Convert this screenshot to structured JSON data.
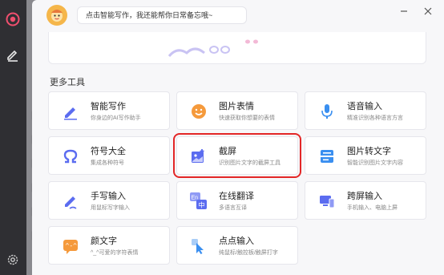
{
  "header": {
    "assistant_message": "点击智能写作，我还能帮你日常备忘哦~",
    "minimize_icon": "minus-icon",
    "close_icon": "close-icon"
  },
  "section": {
    "title": "更多工具"
  },
  "tools": [
    {
      "id": "smart-writing",
      "name": "智能写作",
      "desc": "你身边的AI写作助手",
      "icon": "pen-icon",
      "color": "#5b6cf0"
    },
    {
      "id": "image-emoji",
      "name": "图片表情",
      "desc": "快速获取你想要的表情",
      "icon": "smiley-icon",
      "color": "#f59a3c"
    },
    {
      "id": "voice-input",
      "name": "语音输入",
      "desc": "精准识别各种语言方言",
      "icon": "microphone-icon",
      "color": "#3a8ff0"
    },
    {
      "id": "symbols",
      "name": "符号大全",
      "desc": "集成各种符号",
      "icon": "omega-icon",
      "color": "#5b6cf0"
    },
    {
      "id": "screenshot",
      "name": "截屏",
      "desc": "识别图片文字的截屏工具",
      "icon": "screenshot-icon",
      "color": "#5b6cf0"
    },
    {
      "id": "image-to-text",
      "name": "图片转文字",
      "desc": "智能识别图片文字内容",
      "icon": "scan-text-icon",
      "color": "#3a8ff0"
    },
    {
      "id": "handwriting",
      "name": "手写输入",
      "desc": "用鼠标写字输入",
      "icon": "pencil-icon",
      "color": "#5b6cf0"
    },
    {
      "id": "translate",
      "name": "在线翻译",
      "desc": "多语言互译",
      "icon": "translate-icon",
      "color": "#5b6cf0",
      "badge_en": "En",
      "badge_zh": "中"
    },
    {
      "id": "cross-screen",
      "name": "跨屏输入",
      "desc": "手机输入、电脑上屏",
      "icon": "devices-icon",
      "color": "#5b6cf0"
    },
    {
      "id": "kaomoji",
      "name": "颜文字",
      "desc": "^_^可爱的字符表情",
      "icon": "kaomoji-icon",
      "color": "#f59a3c"
    },
    {
      "id": "click-input",
      "name": "点点输入",
      "desc": "纯鼠标/触控板/触屏打字",
      "icon": "cursor-click-icon",
      "color": "#3a8ff0"
    }
  ],
  "selected_tool": "screenshot",
  "accent_color": "#e32727"
}
